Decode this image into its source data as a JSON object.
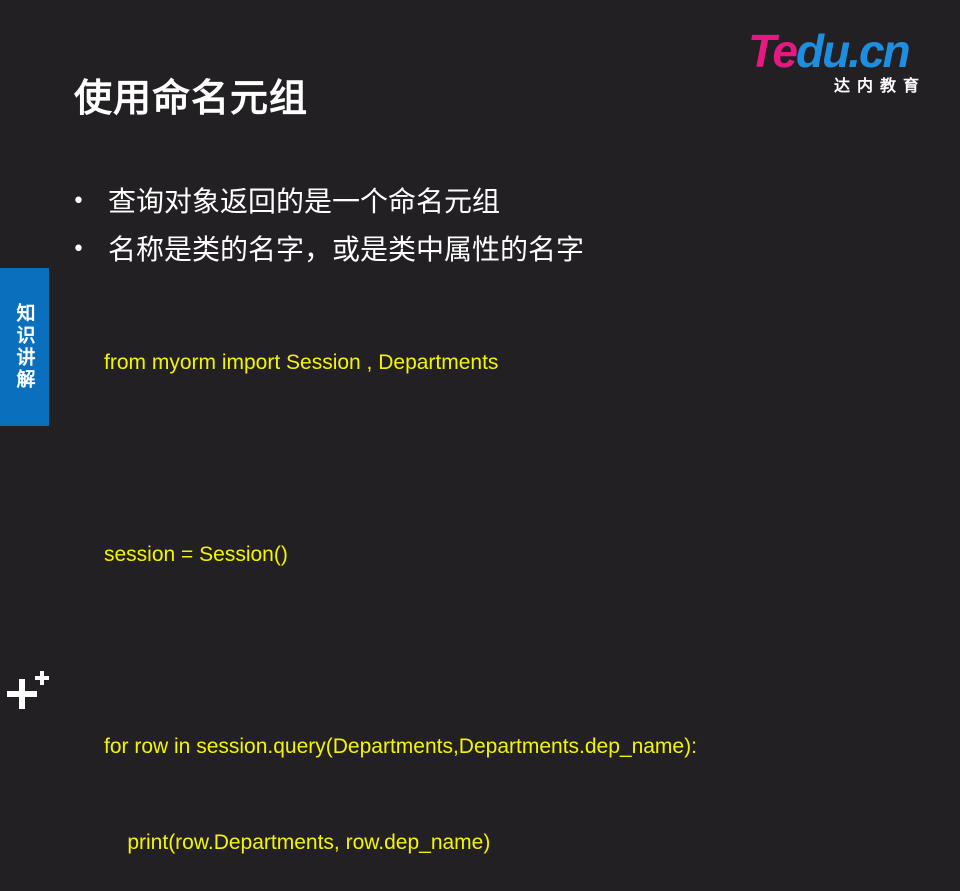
{
  "slide": {
    "title": "使用命名元组"
  },
  "logo": {
    "wordmark_part1": "Te",
    "wordmark_part2": "du.cn",
    "subtitle": "达内教育",
    "colors": {
      "pink": "#e5197f",
      "blue": "#1d8fe0"
    }
  },
  "bullets": [
    {
      "text": "查询对象返回的是一个命名元组"
    },
    {
      "text": "名称是类的名字，或是类中属性的名字"
    }
  ],
  "code": {
    "lines": [
      "from myorm import Session , Departments",
      "",
      "session = Session()",
      "",
      "for row in session.query(Departments,Departments.dep_name):",
      "    print(row.Departments, row.dep_name)"
    ]
  },
  "side_tab": {
    "label": "知识讲解",
    "color": "#0a6fbd"
  },
  "icons": {
    "bullet": "•",
    "bottom_logo": "plus-icon"
  },
  "colors": {
    "background": "#232023",
    "code_text": "#f4f400"
  }
}
